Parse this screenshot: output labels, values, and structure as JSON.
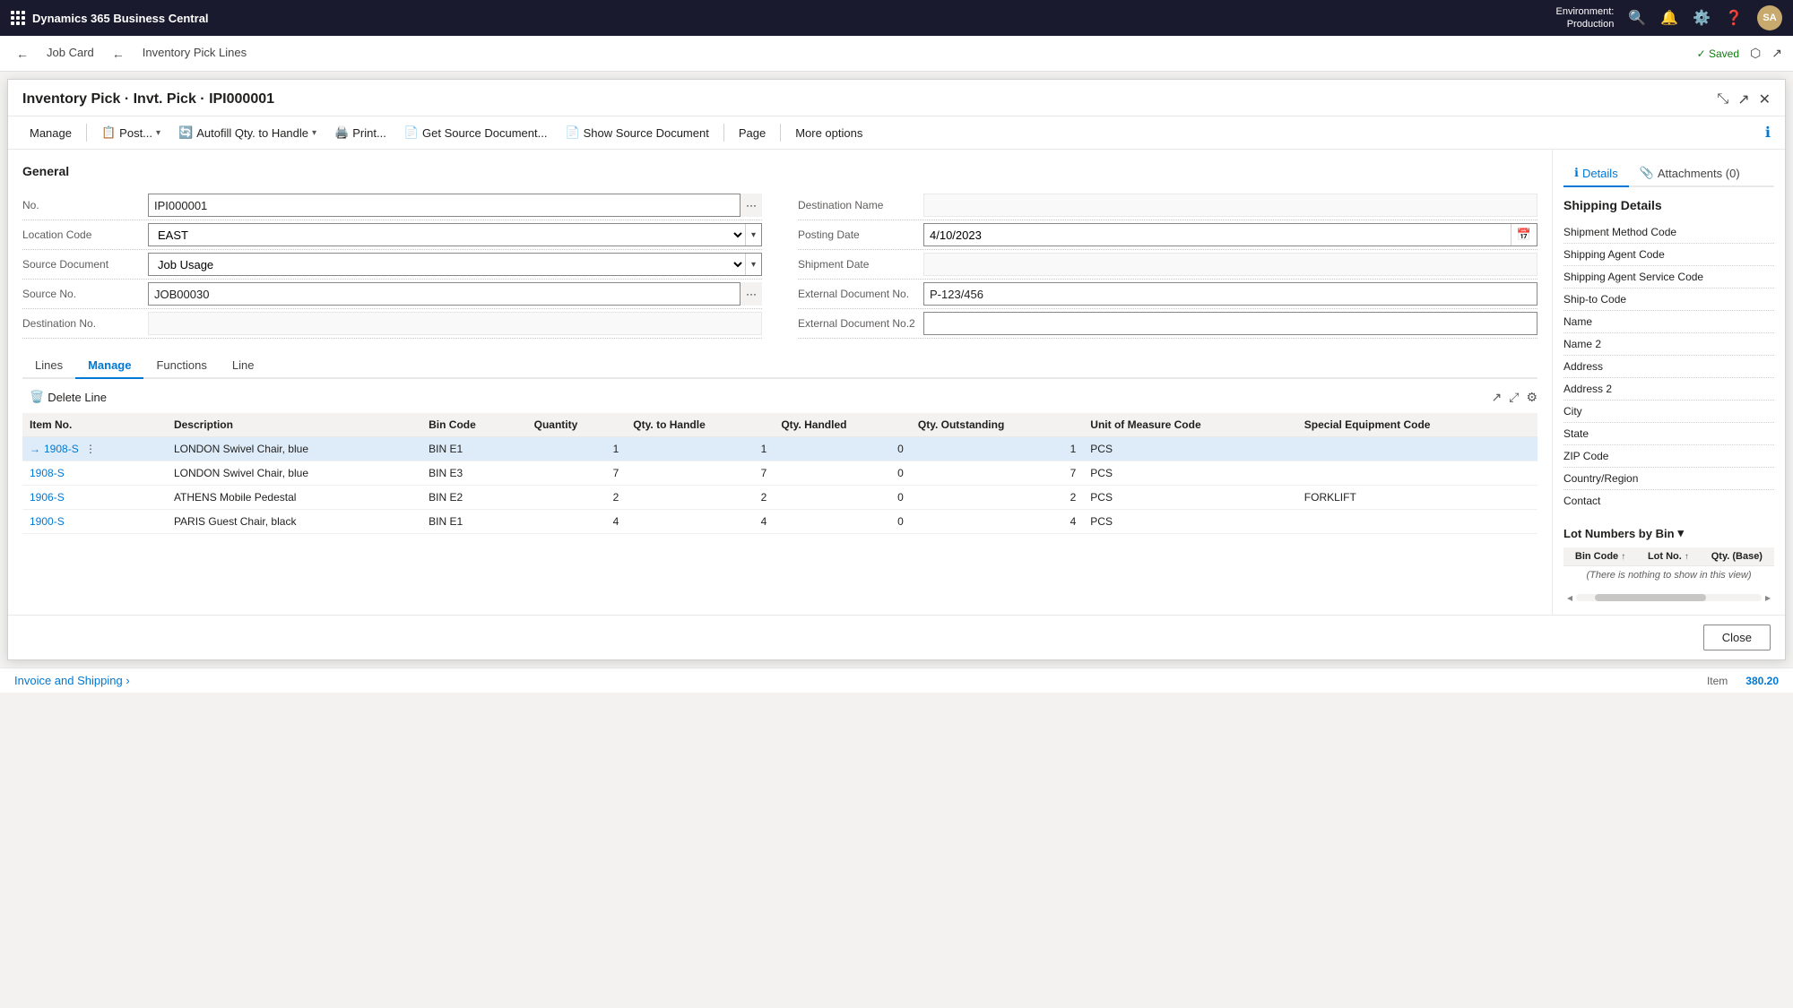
{
  "topNav": {
    "appName": "Dynamics 365 Business Central",
    "env": {
      "label": "Environment:",
      "value": "Production"
    },
    "userInitials": "SA"
  },
  "tabBar": {
    "tabs": [
      {
        "label": "Job Card",
        "back": true
      },
      {
        "label": "Inventory Pick Lines",
        "back": true
      }
    ],
    "savedLabel": "✓ Saved"
  },
  "dialog": {
    "title": "Inventory Pick · Invt. Pick · IPI000001"
  },
  "toolbar": {
    "items": [
      {
        "id": "manage",
        "label": "Manage",
        "icon": ""
      },
      {
        "id": "post",
        "label": "Post...",
        "icon": "📋",
        "hasDropdown": true
      },
      {
        "id": "autofill",
        "label": "Autofill Qty. to Handle",
        "icon": "🔄",
        "hasDropdown": true
      },
      {
        "id": "print",
        "label": "Print...",
        "icon": "🖨️"
      },
      {
        "id": "get-source",
        "label": "Get Source Document...",
        "icon": "📄"
      },
      {
        "id": "show-source",
        "label": "Show Source Document",
        "icon": "📄"
      },
      {
        "id": "page",
        "label": "Page",
        "icon": ""
      },
      {
        "id": "more",
        "label": "More options",
        "icon": ""
      }
    ]
  },
  "general": {
    "title": "General",
    "fields": {
      "no": {
        "label": "No.",
        "value": "IPI000001"
      },
      "locationCode": {
        "label": "Location Code",
        "value": "EAST"
      },
      "sourceDocument": {
        "label": "Source Document",
        "value": "Job Usage"
      },
      "sourceNo": {
        "label": "Source No.",
        "value": "JOB00030"
      },
      "destinationNo": {
        "label": "Destination No.",
        "value": ""
      },
      "destinationName": {
        "label": "Destination Name",
        "value": ""
      },
      "postingDate": {
        "label": "Posting Date",
        "value": "4/10/2023"
      },
      "shipmentDate": {
        "label": "Shipment Date",
        "value": ""
      },
      "externalDocNo": {
        "label": "External Document No.",
        "value": "P-123/456"
      },
      "externalDocNo2": {
        "label": "External Document No.2",
        "value": ""
      }
    }
  },
  "lines": {
    "tabs": [
      {
        "label": "Lines",
        "active": false
      },
      {
        "label": "Manage",
        "active": true
      },
      {
        "label": "Functions",
        "active": false
      },
      {
        "label": "Line",
        "active": false
      }
    ],
    "toolbar": {
      "deleteBtn": "🗑️ Delete Line"
    },
    "columns": [
      {
        "key": "itemNo",
        "label": "Item No."
      },
      {
        "key": "description",
        "label": "Description"
      },
      {
        "key": "binCode",
        "label": "Bin Code"
      },
      {
        "key": "quantity",
        "label": "Quantity"
      },
      {
        "key": "qtyToHandle",
        "label": "Qty. to Handle"
      },
      {
        "key": "qtyHandled",
        "label": "Qty. Handled"
      },
      {
        "key": "qtyOutstanding",
        "label": "Qty. Outstanding"
      },
      {
        "key": "unitOfMeasureCode",
        "label": "Unit of Measure Code"
      },
      {
        "key": "specialEquipmentCode",
        "label": "Special Equipment Code"
      }
    ],
    "rows": [
      {
        "itemNo": "1908-S",
        "description": "LONDON Swivel Chair, blue",
        "binCode": "BIN E1",
        "quantity": "1",
        "qtyToHandle": "1",
        "qtyHandled": "0",
        "qtyOutstanding": "1",
        "unitOfMeasureCode": "PCS",
        "specialEquipmentCode": "",
        "selected": true
      },
      {
        "itemNo": "1908-S",
        "description": "LONDON Swivel Chair, blue",
        "binCode": "BIN E3",
        "quantity": "7",
        "qtyToHandle": "7",
        "qtyHandled": "0",
        "qtyOutstanding": "7",
        "unitOfMeasureCode": "PCS",
        "specialEquipmentCode": "",
        "selected": false
      },
      {
        "itemNo": "1906-S",
        "description": "ATHENS Mobile Pedestal",
        "binCode": "BIN E2",
        "quantity": "2",
        "qtyToHandle": "2",
        "qtyHandled": "0",
        "qtyOutstanding": "2",
        "unitOfMeasureCode": "PCS",
        "specialEquipmentCode": "FORKLIFT",
        "selected": false
      },
      {
        "itemNo": "1900-S",
        "description": "PARIS Guest Chair, black",
        "binCode": "BIN E1",
        "quantity": "4",
        "qtyToHandle": "4",
        "qtyHandled": "0",
        "qtyOutstanding": "4",
        "unitOfMeasureCode": "PCS",
        "specialEquipmentCode": "",
        "selected": false
      }
    ]
  },
  "rightPanel": {
    "tabs": [
      {
        "label": "Details",
        "active": true,
        "icon": "ℹ️"
      },
      {
        "label": "Attachments (0)",
        "active": false,
        "icon": "📎"
      }
    ],
    "shippingDetails": {
      "title": "Shipping Details",
      "fields": [
        "Shipment Method Code",
        "Shipping Agent Code",
        "Shipping Agent Service Code",
        "Ship-to Code",
        "Name",
        "Name 2",
        "Address",
        "Address 2",
        "City",
        "State",
        "ZIP Code",
        "Country/Region",
        "Contact"
      ]
    },
    "lotNumbers": {
      "title": "Lot Numbers by Bin",
      "columns": [
        {
          "label": "Bin Code",
          "sort": "↑"
        },
        {
          "label": "Lot No.",
          "sort": "↑"
        },
        {
          "label": "Qty. (Base)"
        }
      ],
      "emptyMessage": "(There is nothing to show in this view)"
    }
  },
  "footer": {
    "closeBtn": "Close"
  },
  "invoiceSection": {
    "label": "Invoice and Shipping",
    "chevron": "›"
  },
  "bottomInfo": {
    "label": "Item",
    "value": "380.20"
  }
}
